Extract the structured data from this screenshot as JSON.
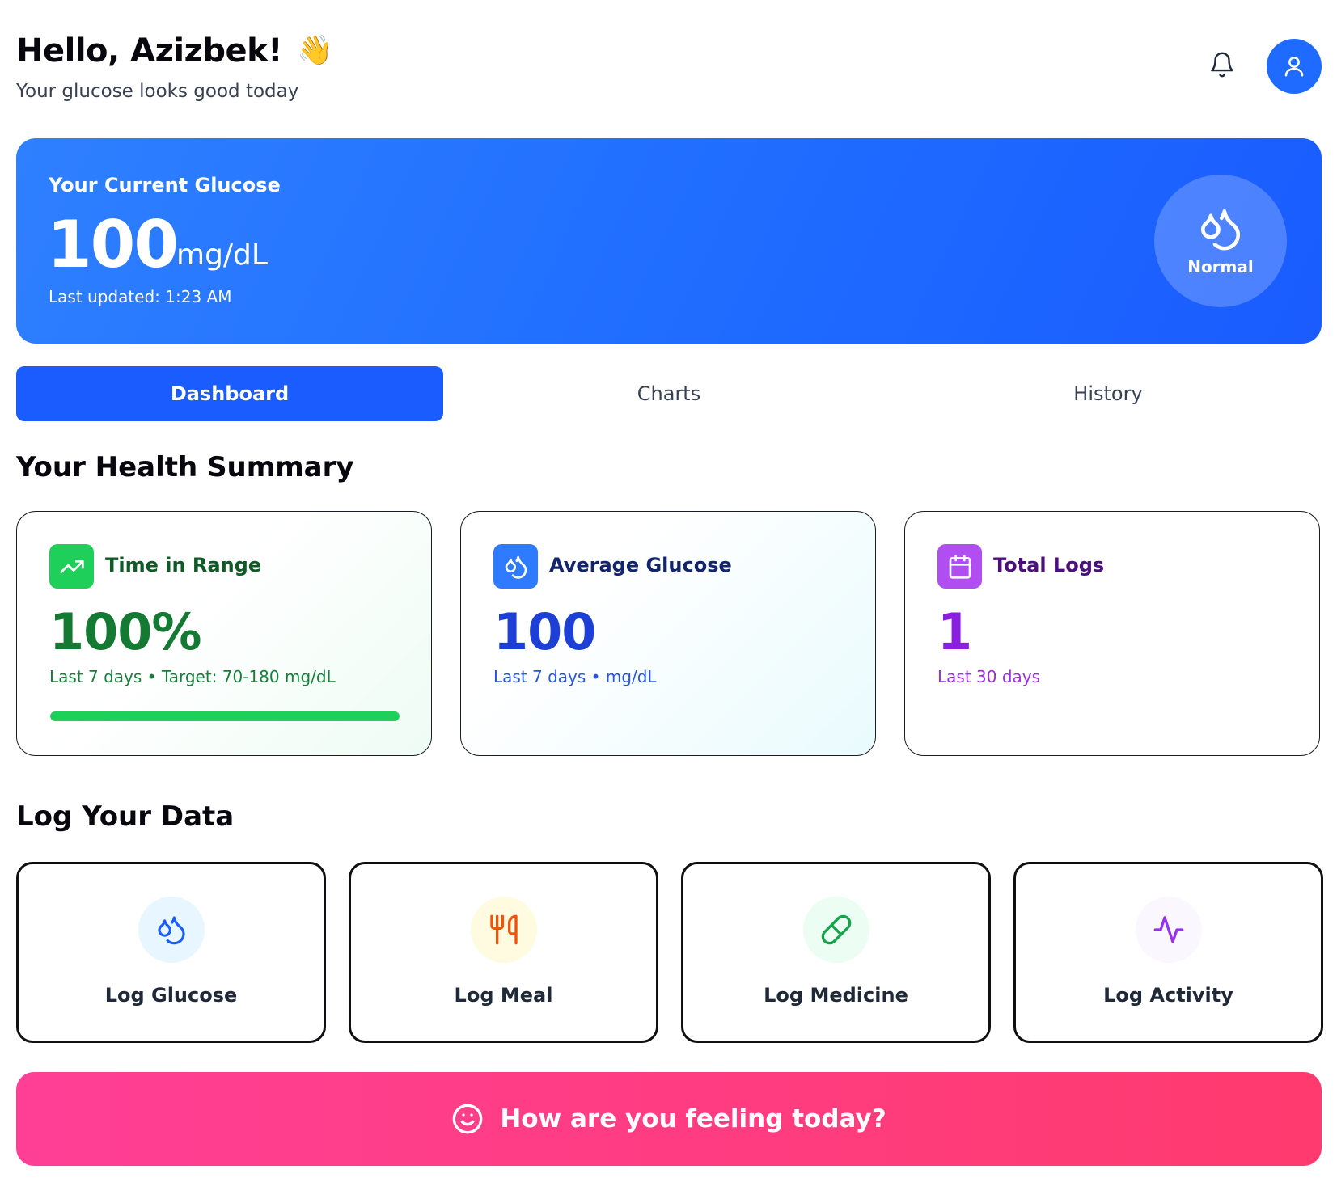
{
  "header": {
    "greeting": "Hello, Azizbek!",
    "wave_emoji": "👋",
    "subtitle": "Your glucose looks good today",
    "notification_icon": "bell-icon",
    "profile_icon": "user-icon"
  },
  "glucose": {
    "title": "Your Current Glucose",
    "value": "100",
    "unit": "mg/dL",
    "last_updated": "Last updated: 1:23 AM",
    "status": "Normal",
    "status_icon": "droplets-icon"
  },
  "tabs": [
    {
      "label": "Dashboard",
      "active": true
    },
    {
      "label": "Charts",
      "active": false
    },
    {
      "label": "History",
      "active": false
    }
  ],
  "summary": {
    "title": "Your Health Summary",
    "cards": [
      {
        "label": "Time in Range",
        "value": "100%",
        "note": "Last 7 days • Target: 70-180 mg/dL",
        "icon": "trending-up-icon",
        "accent": "#16a34a",
        "progress": 1.0
      },
      {
        "label": "Average Glucose",
        "value": "100",
        "note": "Last 7 days • mg/dL",
        "icon": "droplets-icon",
        "accent": "#1d4ed8"
      },
      {
        "label": "Total Logs",
        "value": "1",
        "note": "Last 30 days",
        "icon": "calendar-icon",
        "accent": "#9333ea"
      }
    ]
  },
  "log": {
    "title": "Log Your Data",
    "actions": [
      {
        "label": "Log Glucose",
        "icon": "droplets-icon"
      },
      {
        "label": "Log Meal",
        "icon": "utensils-icon"
      },
      {
        "label": "Log Medicine",
        "icon": "pill-icon"
      },
      {
        "label": "Log Activity",
        "icon": "activity-icon"
      }
    ]
  },
  "feeling": {
    "label": "How are you feeling today?",
    "icon": "smile-icon"
  },
  "colors": {
    "primary": "#1a5cff",
    "success": "#1ed05a",
    "feeling_gradient_start": "#ff3f96",
    "feeling_gradient_end": "#ff3a6e"
  }
}
